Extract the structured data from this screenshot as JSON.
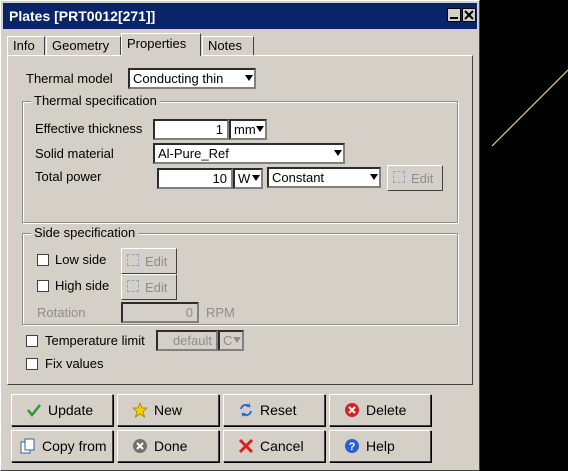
{
  "window": {
    "title": "Plates [PRT0012[271]]"
  },
  "tabs": [
    {
      "label": "Info"
    },
    {
      "label": "Geometry"
    },
    {
      "label": "Properties",
      "active": true
    },
    {
      "label": "Notes"
    }
  ],
  "thermal_model": {
    "label": "Thermal model",
    "value": "Conducting thin"
  },
  "thermal_spec": {
    "title": "Thermal specification",
    "effective_thickness": {
      "label": "Effective thickness",
      "value": "1",
      "unit": "mm"
    },
    "solid_material": {
      "label": "Solid material",
      "value": "Al-Pure_Ref"
    },
    "total_power": {
      "label": "Total power",
      "value": "10",
      "unit": "W",
      "mode": "Constant",
      "edit_label": "Edit"
    }
  },
  "side_spec": {
    "title": "Side specification",
    "low_side": {
      "label": "Low side",
      "checked": false,
      "edit_label": "Edit"
    },
    "high_side": {
      "label": "High side",
      "checked": false,
      "edit_label": "Edit"
    },
    "rotation": {
      "label": "Rotation",
      "value": "0",
      "unit": "RPM"
    }
  },
  "temperature_limit": {
    "label": "Temperature limit",
    "checked": false,
    "value": "default",
    "unit": "C"
  },
  "fix_values": {
    "label": "Fix values",
    "checked": false
  },
  "buttons": {
    "update": "Update",
    "new": "New",
    "reset": "Reset",
    "delete": "Delete",
    "copy_from": "Copy from",
    "done": "Done",
    "cancel": "Cancel",
    "help": "Help"
  },
  "colors": {
    "titlebar": "#0a246a",
    "dialog": "#d4d0c8",
    "viewport": "#000000",
    "viewport_line": "#e6d27a"
  }
}
